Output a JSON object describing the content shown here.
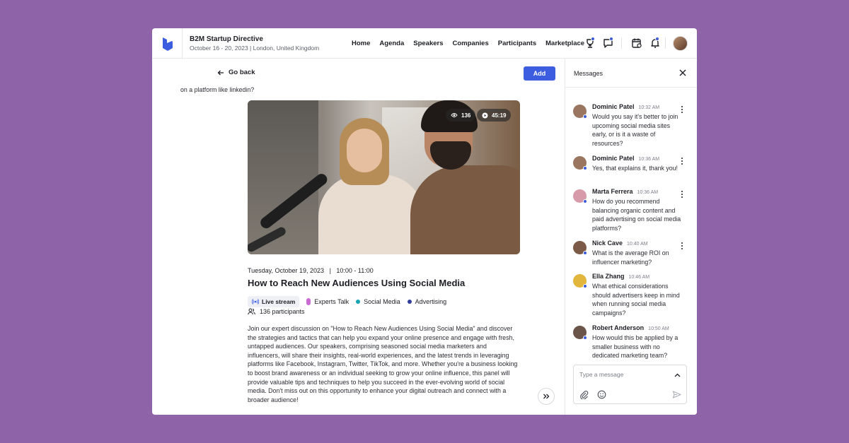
{
  "header": {
    "event_title": "B2M Startup Directive",
    "event_subtitle": "October 16 - 20, 2023  |  London, United Kingdom",
    "nav": [
      "Home",
      "Agenda",
      "Speakers",
      "Companies",
      "Participants",
      "Marketplace"
    ],
    "icons": [
      "trophy-icon",
      "chat-icon",
      "calendar-icon",
      "bell-icon"
    ],
    "accent": "#3c5de0"
  },
  "main": {
    "go_back": "Go back",
    "add_label": "Add",
    "video": {
      "views": "136",
      "duration": "45:19"
    },
    "date_line": "Tuesday, October 19, 2023   |   10:00 - 11:00",
    "title": "How to Reach New Audiences Using Social Media",
    "live_label": "Live stream",
    "tags": [
      {
        "label": "Experts Talk",
        "color": "#c96bd3"
      },
      {
        "label": "Social Media",
        "color": "#16a3b4"
      },
      {
        "label": "Advertising",
        "color": "#2f3d9e"
      }
    ],
    "participants": "136 participants",
    "description": "Join our expert discussion on \"How to Reach New Audiences Using Social Media\" and discover the strategies and tactics that can help you expand your online presence and engage with fresh, untapped audiences. Our speakers, comprising seasoned social media marketers and influencers, will share their insights, real-world experiences, and the latest trends in leveraging platforms like Facebook, Instagram, Twitter, TikTok, and more. Whether you're a business looking to boost brand awareness or an individual seeking to grow your online influence, this panel will provide valuable tips and techniques to help you succeed in the ever-evolving world of social media. Don't miss out on this opportunity to enhance your digital outreach and connect with a broader audience!"
  },
  "messages": {
    "title": "Messages",
    "clipped_text": "on a platform like linkedin?",
    "items": [
      {
        "name": "Dominic Patel",
        "time": "10:32 AM",
        "text": "Would you say it's better to join upcoming social media sites early, or is it a waste of resources?",
        "avatar_color": "#9a7660"
      },
      {
        "name": "Dominic Patel",
        "time": "10:36 AM",
        "text": "Yes, that explains it, thank you!",
        "avatar_color": "#9a7660"
      },
      {
        "name": "Marta Ferrera",
        "time": "10:36 AM",
        "text": "How do you recommend balancing organic content and paid advertising on social media platforms?",
        "avatar_color": "#d69aa8"
      },
      {
        "name": "Nick Cave",
        "time": "10:40 AM",
        "text": "What is the average ROI on influencer marketing?",
        "avatar_color": "#7b5a48"
      },
      {
        "name": "Ella Zhang",
        "time": "10:46 AM",
        "text": "What ethical considerations should advertisers keep in mind when running social media campaigns?",
        "avatar_color": "#e2b63c"
      },
      {
        "name": "Robert Anderson",
        "time": "10:50 AM",
        "text": "How would this be applied by a smaller business with no dedicated marketing team?",
        "avatar_color": "#6b5449"
      }
    ],
    "compose_placeholder": "Type a message"
  }
}
